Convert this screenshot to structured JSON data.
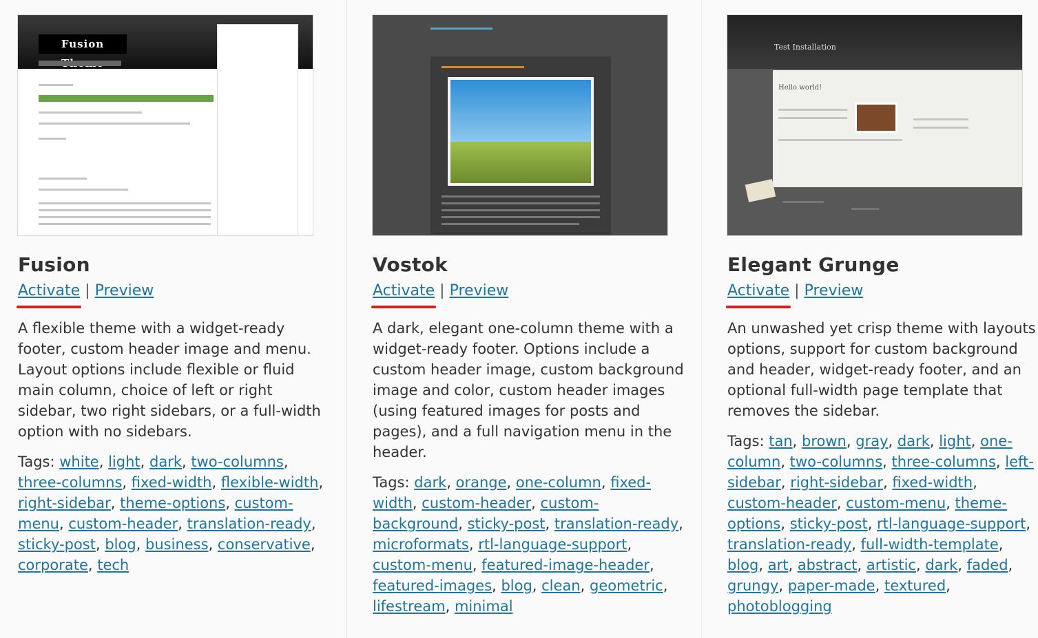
{
  "themes": [
    {
      "name": "Fusion",
      "activate_label": "Activate",
      "separator": "|",
      "preview_label": "Preview",
      "description": "A flexible theme with a widget-ready footer, custom header image and menu. Layout options include flexible or fluid main column, choice of left or right sidebar, two right sidebars, or a full-width option with no sidebars.",
      "tags_label": "Tags:",
      "tags": [
        "white",
        "light",
        "dark",
        "two-columns",
        "three-columns",
        "fixed-width",
        "flexible-width",
        "right-sidebar",
        "theme-options",
        "custom-menu",
        "custom-header",
        "translation-ready",
        "sticky-post",
        "blog",
        "business",
        "conservative",
        "corporate",
        "tech"
      ],
      "thumb_logo": "Fusion Theme"
    },
    {
      "name": "Vostok",
      "activate_label": "Activate",
      "separator": "|",
      "preview_label": "Preview",
      "description": "A dark, elegant one-column theme with a widget-ready footer. Options include a custom header image, custom background image and color, custom header images (using featured images for posts and pages), and a full navigation menu in the header.",
      "tags_label": "Tags:",
      "tags": [
        "dark",
        "orange",
        "one-column",
        "fixed-width",
        "custom-header",
        "custom-background",
        "sticky-post",
        "translation-ready",
        "microformats",
        "rtl-language-support",
        "custom-menu",
        "featured-image-header",
        "featured-images",
        "blog",
        "clean",
        "geometric",
        "lifestream",
        "minimal"
      ]
    },
    {
      "name": "Elegant Grunge",
      "activate_label": "Activate",
      "separator": "|",
      "preview_label": "Preview",
      "description": "An unwashed yet crisp theme with layouts options, support for custom background and header, widget-ready footer, and an optional full-width page template that removes the sidebar.",
      "tags_label": "Tags:",
      "tags": [
        "tan",
        "brown",
        "gray",
        "dark",
        "light",
        "one-column",
        "two-columns",
        "three-columns",
        "left-sidebar",
        "right-sidebar",
        "fixed-width",
        "custom-header",
        "custom-menu",
        "theme-options",
        "sticky-post",
        "rtl-language-support",
        "translation-ready",
        "full-width-template",
        "blog",
        "art",
        "abstract",
        "artistic",
        "dark",
        "faded",
        "grungy",
        "paper-made",
        "textured",
        "photoblogging"
      ],
      "thumb_title": "Test Installation",
      "thumb_post": "Hello world!"
    }
  ],
  "colors": {
    "link": "#21759b",
    "highlight_underline": "#d32020"
  }
}
